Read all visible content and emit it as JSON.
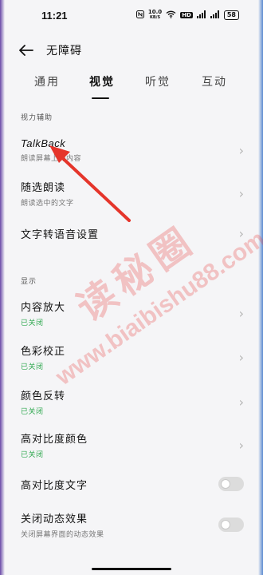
{
  "status_bar": {
    "time": "11:21",
    "network_rate": "10.0",
    "network_unit": "KB/S",
    "hd_label": "HD",
    "battery": "58"
  },
  "header": {
    "title": "无障碍"
  },
  "tabs": [
    {
      "label": "通用"
    },
    {
      "label": "视觉"
    },
    {
      "label": "听觉"
    },
    {
      "label": "互动"
    }
  ],
  "sections": {
    "vision_assist": "视力辅助",
    "display": "显示"
  },
  "items": {
    "talkback": {
      "title": "TalkBack",
      "sub": "朗读屏幕上的内容"
    },
    "select_to_speak": {
      "title": "随选朗读",
      "sub": "朗读选中的文字"
    },
    "tts": {
      "title": "文字转语音设置"
    },
    "magnify": {
      "title": "内容放大",
      "sub": "已关闭"
    },
    "color_correction": {
      "title": "色彩校正",
      "sub": "已关闭"
    },
    "color_inversion": {
      "title": "颜色反转",
      "sub": "已关闭"
    },
    "high_contrast_color": {
      "title": "高对比度颜色",
      "sub": "已关闭"
    },
    "high_contrast_text": {
      "title": "高对比度文字",
      "state": "off"
    },
    "remove_animations": {
      "title": "关闭动态效果",
      "sub": "关闭屏幕界面的动态效果",
      "state": "off"
    }
  },
  "watermark": {
    "cn": "读秘圈",
    "url": "www.biaibishu88.com"
  },
  "colors": {
    "accent_green": "#2fa84f",
    "annotation_red": "#e5352b"
  }
}
